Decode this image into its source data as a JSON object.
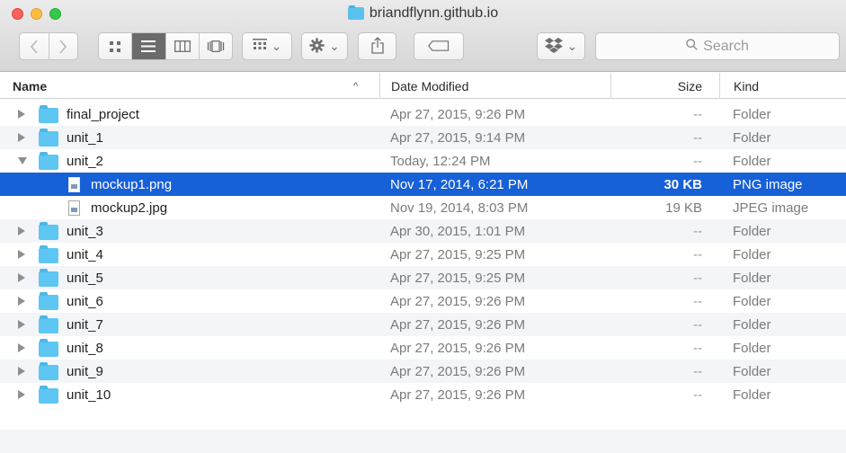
{
  "window": {
    "title": "briandflynn.github.io"
  },
  "toolbar": {
    "back_icon": "chevron-left-icon",
    "forward_icon": "chevron-right-icon",
    "view_modes": [
      "icon-view-icon",
      "list-view-icon",
      "column-view-icon",
      "cover-flow-icon"
    ],
    "active_view": "list-view-icon",
    "arrange_icon": "arrange-grid-icon",
    "action_icon": "gear-icon",
    "share_icon": "share-icon",
    "tag_icon": "tag-icon",
    "dropbox_icon": "dropbox-icon",
    "dropdown_caret": "⌄",
    "search": {
      "placeholder": "Search"
    }
  },
  "columns": {
    "name": "Name",
    "date": "Date Modified",
    "size": "Size",
    "kind": "Kind",
    "sort_indicator": "^"
  },
  "files": [
    {
      "name": "final_project",
      "date": "Apr 27, 2015, 9:26 PM",
      "size": "--",
      "kind": "Folder",
      "type": "folder",
      "expanded": false
    },
    {
      "name": "unit_1",
      "date": "Apr 27, 2015, 9:14 PM",
      "size": "--",
      "kind": "Folder",
      "type": "folder",
      "expanded": false
    },
    {
      "name": "unit_2",
      "date": "Today, 12:24 PM",
      "size": "--",
      "kind": "Folder",
      "type": "folder",
      "expanded": true
    },
    {
      "name": "mockup1.png",
      "date": "Nov 17, 2014, 6:21 PM",
      "size": "30 KB",
      "kind": "PNG image",
      "type": "file",
      "selected": true
    },
    {
      "name": "mockup2.jpg",
      "date": "Nov 19, 2014, 8:03 PM",
      "size": "19 KB",
      "kind": "JPEG image",
      "type": "file"
    },
    {
      "name": "unit_3",
      "date": "Apr 30, 2015, 1:01 PM",
      "size": "--",
      "kind": "Folder",
      "type": "folder",
      "expanded": false
    },
    {
      "name": "unit_4",
      "date": "Apr 27, 2015, 9:25 PM",
      "size": "--",
      "kind": "Folder",
      "type": "folder",
      "expanded": false
    },
    {
      "name": "unit_5",
      "date": "Apr 27, 2015, 9:25 PM",
      "size": "--",
      "kind": "Folder",
      "type": "folder",
      "expanded": false
    },
    {
      "name": "unit_6",
      "date": "Apr 27, 2015, 9:26 PM",
      "size": "--",
      "kind": "Folder",
      "type": "folder",
      "expanded": false
    },
    {
      "name": "unit_7",
      "date": "Apr 27, 2015, 9:26 PM",
      "size": "--",
      "kind": "Folder",
      "type": "folder",
      "expanded": false
    },
    {
      "name": "unit_8",
      "date": "Apr 27, 2015, 9:26 PM",
      "size": "--",
      "kind": "Folder",
      "type": "folder",
      "expanded": false
    },
    {
      "name": "unit_9",
      "date": "Apr 27, 2015, 9:26 PM",
      "size": "--",
      "kind": "Folder",
      "type": "folder",
      "expanded": false
    },
    {
      "name": "unit_10",
      "date": "Apr 27, 2015, 9:26 PM",
      "size": "--",
      "kind": "Folder",
      "type": "folder",
      "expanded": false
    }
  ],
  "colors": {
    "selection": "#1660d8",
    "folder": "#5ec6f2",
    "stripe": "#f3f5f8"
  }
}
